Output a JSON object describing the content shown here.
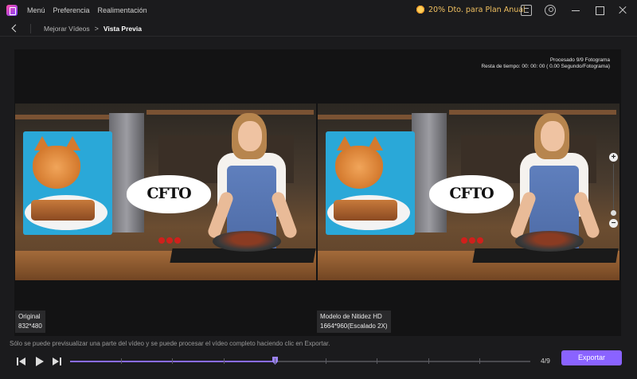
{
  "menu": {
    "items": [
      "Menú",
      "Preferencia",
      "Realimentación"
    ]
  },
  "promo": {
    "text": "20% Dto. para Plan Anual",
    "icon": "sun-icon",
    "color": "#f0c060"
  },
  "breadcrumb": {
    "parent": "Mejorar Vídeos",
    "separator": ">",
    "current": "Vista Previa"
  },
  "processing": {
    "line1": "Procesado 9/9 Fotograma",
    "line2": "Resta de tiempo: 00: 00: 00 ( 0.00 Segundo/Fotograma)"
  },
  "overlay_text": "CFTO",
  "labels": {
    "left": {
      "title": "Original",
      "resolution": "832*480"
    },
    "right": {
      "title": "Modelo de Nitidez HD",
      "resolution": "1664*960(Escalado 2X)"
    }
  },
  "note": "Sólo se puede previsualizar una parte del vídeo y se puede procesar el vídeo completo haciendo clic en Exportar.",
  "player": {
    "counter": "4/9",
    "current_frame": 4,
    "total_frames": 9
  },
  "export_label": "Exportar",
  "colors": {
    "accent": "#8a63ff",
    "background": "#1b1b1d",
    "panel": "#131314"
  }
}
